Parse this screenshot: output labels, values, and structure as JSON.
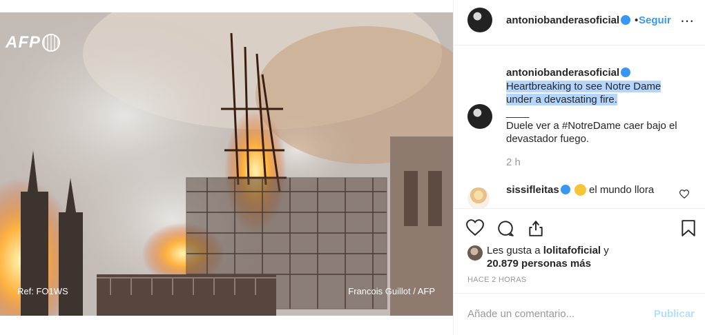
{
  "photo": {
    "logo_text": "AFP",
    "ref_text": "Ref: FO1WS",
    "credit_text": "Francois Guillot / AFP"
  },
  "header": {
    "username": "antoniobanderasoficial",
    "separator": "•",
    "follow_label": "Seguir",
    "more_icon": "⋯"
  },
  "caption": {
    "username": "antoniobanderasoficial",
    "line1": "Heartbreaking to see Notre Dame",
    "line2": "under a devastating fire.",
    "line3": "____",
    "line4": "Duele ver a #NotreDame caer bajo el",
    "line5": "devastador fuego.",
    "time": "2 h"
  },
  "comment": {
    "username": "sissifleitas",
    "text": "el mundo llora"
  },
  "likes": {
    "prefix": "Les gusta a ",
    "user": "lolitafoficial",
    "suffix": " y",
    "count": "20.879 personas más"
  },
  "post_time": "HACE 2 HORAS",
  "add_comment": {
    "placeholder": "Añade un comentario...",
    "publish_label": "Publicar"
  },
  "colors": {
    "accent": "#3897f0",
    "highlight": "#b4d5fe",
    "publish_disabled": "#b2dffc",
    "muted": "#999999"
  },
  "icons": [
    "heart-icon",
    "comment-icon",
    "share-icon",
    "bookmark-icon",
    "verified-badge-icon",
    "crying-emoji-icon"
  ]
}
